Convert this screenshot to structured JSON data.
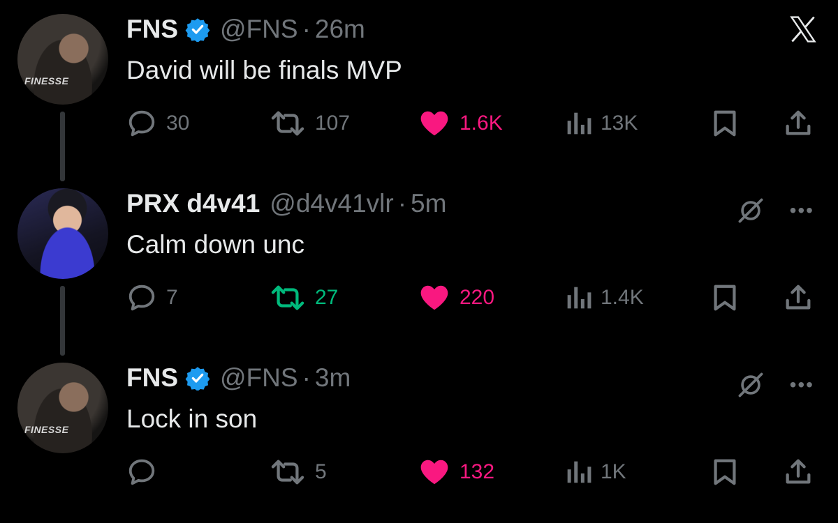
{
  "colors": {
    "background": "#000000",
    "text_primary": "#e7e9ea",
    "text_secondary": "#71767b",
    "verified_blue": "#1d9bf0",
    "like_pink": "#f91880",
    "retweet_green": "#00ba7c"
  },
  "app": {
    "logo_icon": "x-logo-icon"
  },
  "tweets": [
    {
      "display_name": "FNS",
      "verified": true,
      "handle": "@FNS",
      "time": "26m",
      "text": "David will be finals MVP",
      "avatar_label": "FINESSE",
      "replies": "30",
      "retweets": "107",
      "retweets_active": false,
      "likes": "1.6K",
      "views": "13K"
    },
    {
      "display_name": "PRX d4v41",
      "verified": false,
      "handle": "@d4v41vlr",
      "time": "5m",
      "text": "Calm down unc",
      "replies": "7",
      "retweets": "27",
      "retweets_active": true,
      "likes": "220",
      "views": "1.4K"
    },
    {
      "display_name": "FNS",
      "verified": true,
      "handle": "@FNS",
      "time": "3m",
      "text": "Lock in son",
      "avatar_label": "FINESSE",
      "replies": "",
      "retweets": "5",
      "retweets_active": false,
      "likes": "132",
      "views": "1K"
    }
  ]
}
